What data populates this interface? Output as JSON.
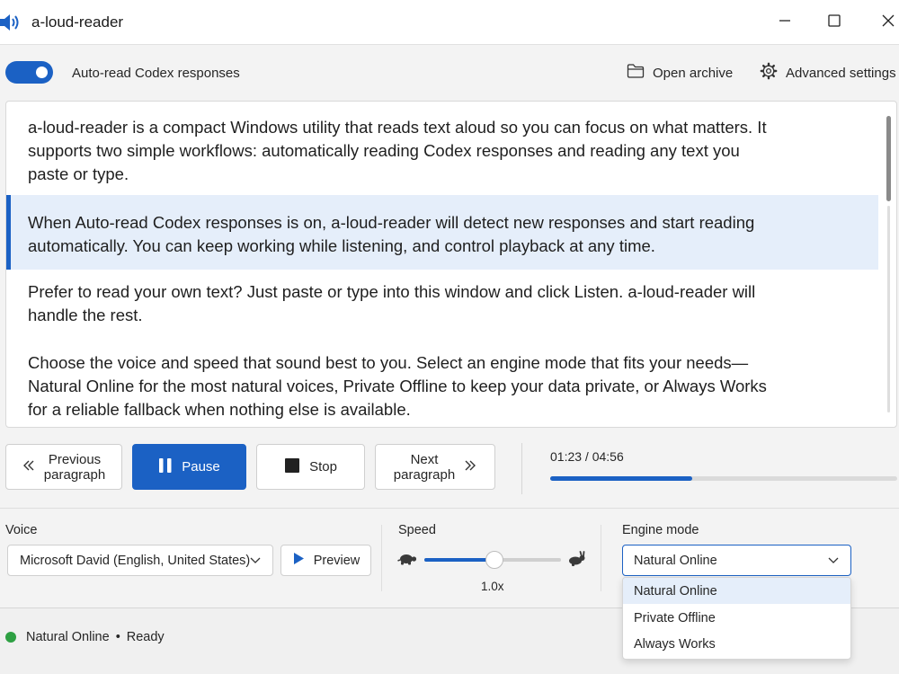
{
  "window": {
    "title": "a-loud-reader",
    "app_icon": "speaker-icon",
    "controls": [
      "minimize-icon",
      "maximize-icon",
      "close-icon"
    ]
  },
  "toolbar": {
    "auto_read_label": "Auto-read Codex responses",
    "auto_read_on": true,
    "open_archive_label": "Open archive",
    "open_archive_icon": "folder-icon",
    "advanced_settings_label": "Advanced settings",
    "advanced_settings_icon": "gear-icon"
  },
  "reader": {
    "paragraphs": [
      "a-loud-reader is a compact Windows utility that reads text aloud so you can focus on what matters. It supports two simple workflows: automatically reading Codex responses and reading any text you paste or type.",
      "When Auto-read Codex responses is on, a-loud-reader will detect new responses and start reading automatically. You can keep working while listening, and control playback at any time.",
      "Prefer to read your own text? Just paste or type into this window and click Listen. a-loud-reader will handle the rest.",
      "Choose the voice and speed that sound best to you. Select an engine mode that fits your needs—Natural Online for the most natural voices, Private Offline to keep your data private, or Always Works for a reliable fallback when nothing else is available."
    ],
    "highlighted_paragraph_index": 1
  },
  "playback": {
    "previous_label_line1": "Previous",
    "previous_label_line2": "paragraph",
    "pause_label": "Pause",
    "stop_label": "Stop",
    "next_label_line1": "Next",
    "next_label_line2": "paragraph",
    "time_display": "01:23 / 04:56",
    "progress_fraction": 0.41
  },
  "settings": {
    "voice_label": "Voice",
    "voice_selected": "Microsoft David (English, United States)",
    "preview_label": "Preview",
    "speed_label": "Speed",
    "speed_value": "1.0x",
    "speed_fraction": 0.51,
    "engine_label": "Engine mode",
    "engine_selected": "Natural Online",
    "engine_options": [
      "Natural Online",
      "Private Offline",
      "Always Works"
    ]
  },
  "status": {
    "engine": "Natural Online",
    "separator": "•",
    "state": "Ready",
    "dot_color": "#2ea043"
  },
  "colors": {
    "accent": "#1b61c4",
    "highlight_bg": "#e5eefa"
  }
}
